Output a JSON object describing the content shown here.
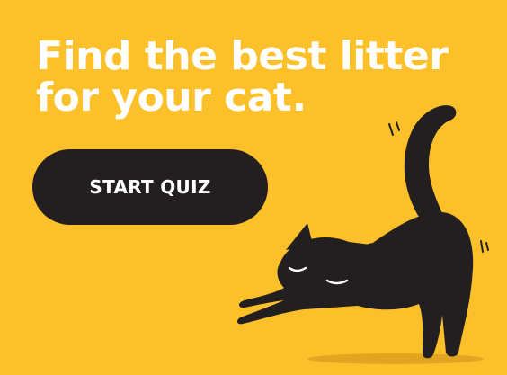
{
  "banner": {
    "headline_line1": "Find the best litter",
    "headline_line2": "for your cat.",
    "cta_label": "START QUIZ"
  },
  "colors": {
    "background": "#FBC02A",
    "text": "#FFFFFF",
    "button": "#231F20",
    "cat": "#231F20",
    "shadow": "#E3A520"
  },
  "illustration": {
    "icon": "stretching-cat-icon"
  }
}
